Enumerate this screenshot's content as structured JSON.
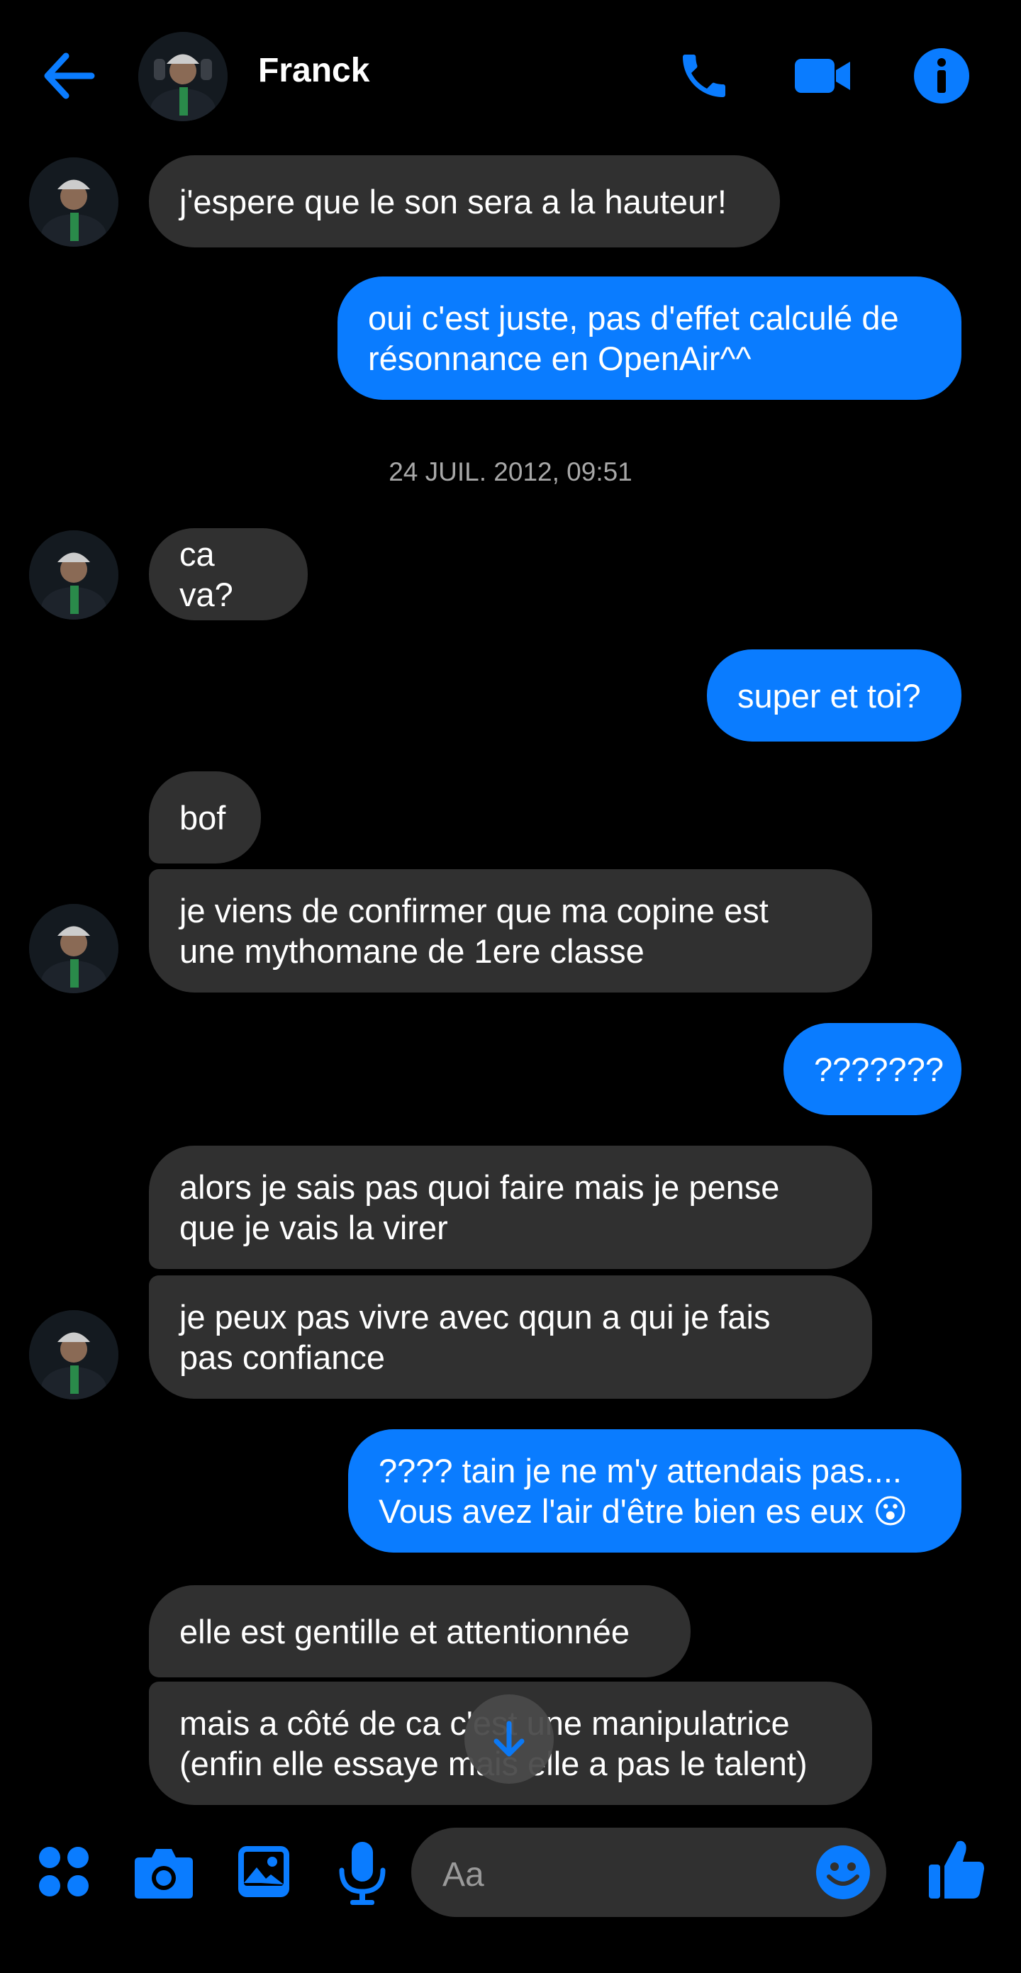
{
  "header": {
    "contact_name": "Franck",
    "icons": [
      "back-arrow-icon",
      "phone-icon",
      "video-camera-icon",
      "info-icon"
    ]
  },
  "messages": [
    {
      "from": "them",
      "text": "j'espere que le son sera a la hauteur!"
    },
    {
      "from": "me",
      "lines": [
        "oui c'est juste, pas d'effet calculé de",
        "résonnance en OpenAir^^"
      ]
    },
    {
      "type": "timestamp",
      "text": "24 JUIL. 2012, 09:51"
    },
    {
      "from": "them",
      "text": "ca va?"
    },
    {
      "from": "me",
      "text": "super et toi?"
    },
    {
      "from": "them",
      "text": "bof"
    },
    {
      "from": "them",
      "lines": [
        "je viens de confirmer que ma copine est",
        "une mythomane de 1ere classe"
      ]
    },
    {
      "from": "me",
      "text": "???????"
    },
    {
      "from": "them",
      "lines": [
        "alors je sais pas quoi faire mais je pense",
        "que je vais la virer"
      ]
    },
    {
      "from": "them",
      "lines": [
        "je peux pas vivre avec qqun a qui je fais",
        "pas confiance"
      ]
    },
    {
      "from": "me",
      "lines": [
        "???? tain je ne m'y attendais pas....",
        "Vous avez l'air d'être bien es eux"
      ],
      "emoji": "😮"
    },
    {
      "from": "them",
      "text": "elle est gentille et attentionnée"
    },
    {
      "from": "them",
      "lines": [
        "mais a côté de ca c'est une manipulatrice",
        "(enfin elle essaye mais elle a pas le talent)"
      ]
    }
  ],
  "composer": {
    "placeholder": "Aa",
    "icons": [
      "apps-grid-icon",
      "camera-icon",
      "gallery-icon",
      "microphone-icon",
      "emoji-icon",
      "thumbs-up-icon"
    ]
  },
  "colors": {
    "accent": "#0a7cff",
    "background": "#000000",
    "incoming_bubble": "#303030",
    "timestamp_text": "#a8a8a8"
  }
}
